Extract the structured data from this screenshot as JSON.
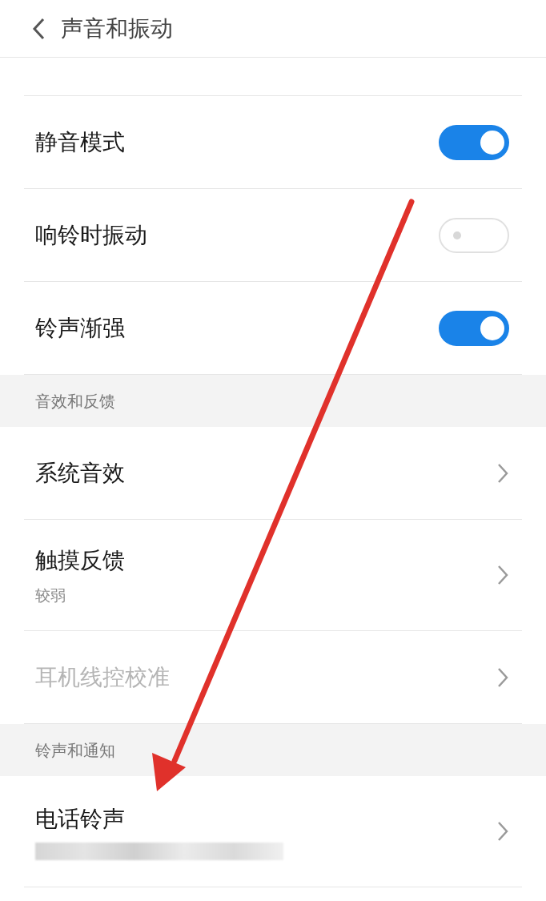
{
  "header": {
    "title": "声音和振动"
  },
  "sections": [
    {
      "rows": [
        {
          "kind": "toggle",
          "label": "静音模式",
          "on": true
        },
        {
          "kind": "toggle",
          "label": "响铃时振动",
          "on": false
        },
        {
          "kind": "toggle",
          "label": "铃声渐强",
          "on": true
        }
      ]
    },
    {
      "title": "音效和反馈",
      "rows": [
        {
          "kind": "link",
          "label": "系统音效",
          "disabled": false
        },
        {
          "kind": "link",
          "label": "触摸反馈",
          "subtitle": "较弱",
          "disabled": false
        },
        {
          "kind": "link",
          "label": "耳机线控校准",
          "disabled": true
        }
      ]
    },
    {
      "title": "铃声和通知",
      "rows": [
        {
          "kind": "link",
          "label": "电话铃声",
          "redacted": true,
          "disabled": false
        }
      ]
    }
  ]
}
